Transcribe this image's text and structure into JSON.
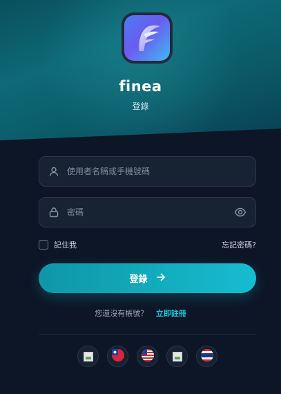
{
  "app": {
    "name": "finea",
    "subtitle": "登錄",
    "logo_icon": "finea-logo-f"
  },
  "form": {
    "username": {
      "placeholder": "使用者名稱或手機號碼",
      "value": "",
      "icon": "user-icon"
    },
    "password": {
      "placeholder": "密碼",
      "value": "",
      "icon": "lock-icon",
      "toggle_icon": "eye-icon"
    },
    "remember_label": "記住我",
    "remember_checked": false,
    "forgot_label": "忘記密碼?",
    "submit_label": "登錄",
    "submit_icon": "arrow-right-icon"
  },
  "signup": {
    "question": "您還沒有帳號？",
    "link_label": "立即註冊"
  },
  "languages": [
    {
      "icon": "broken-image-icon"
    },
    {
      "icon": "flag-taiwan-icon"
    },
    {
      "icon": "flag-us-icon"
    },
    {
      "icon": "broken-image-icon"
    },
    {
      "icon": "flag-thailand-icon"
    }
  ],
  "colors": {
    "accent": "#12aabb",
    "link": "#1fc3d6",
    "background": "#0d1626",
    "hero": "#0d6a76"
  }
}
